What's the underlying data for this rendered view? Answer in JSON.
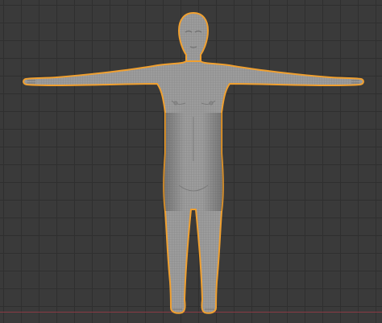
{
  "app": {
    "title": "",
    "mode": "object-mode",
    "view": "front-orthographic"
  },
  "viewport": {
    "background_color": "#3a3a3a",
    "grid_line_color": "#2f2f2f",
    "x_axis_color": "#8a3a44"
  },
  "selected_object": {
    "type": "humanoid-mesh",
    "outline_color": "#f0a030",
    "mesh_color": "#9a9a9a",
    "wire_color": "#7c7c7c"
  }
}
